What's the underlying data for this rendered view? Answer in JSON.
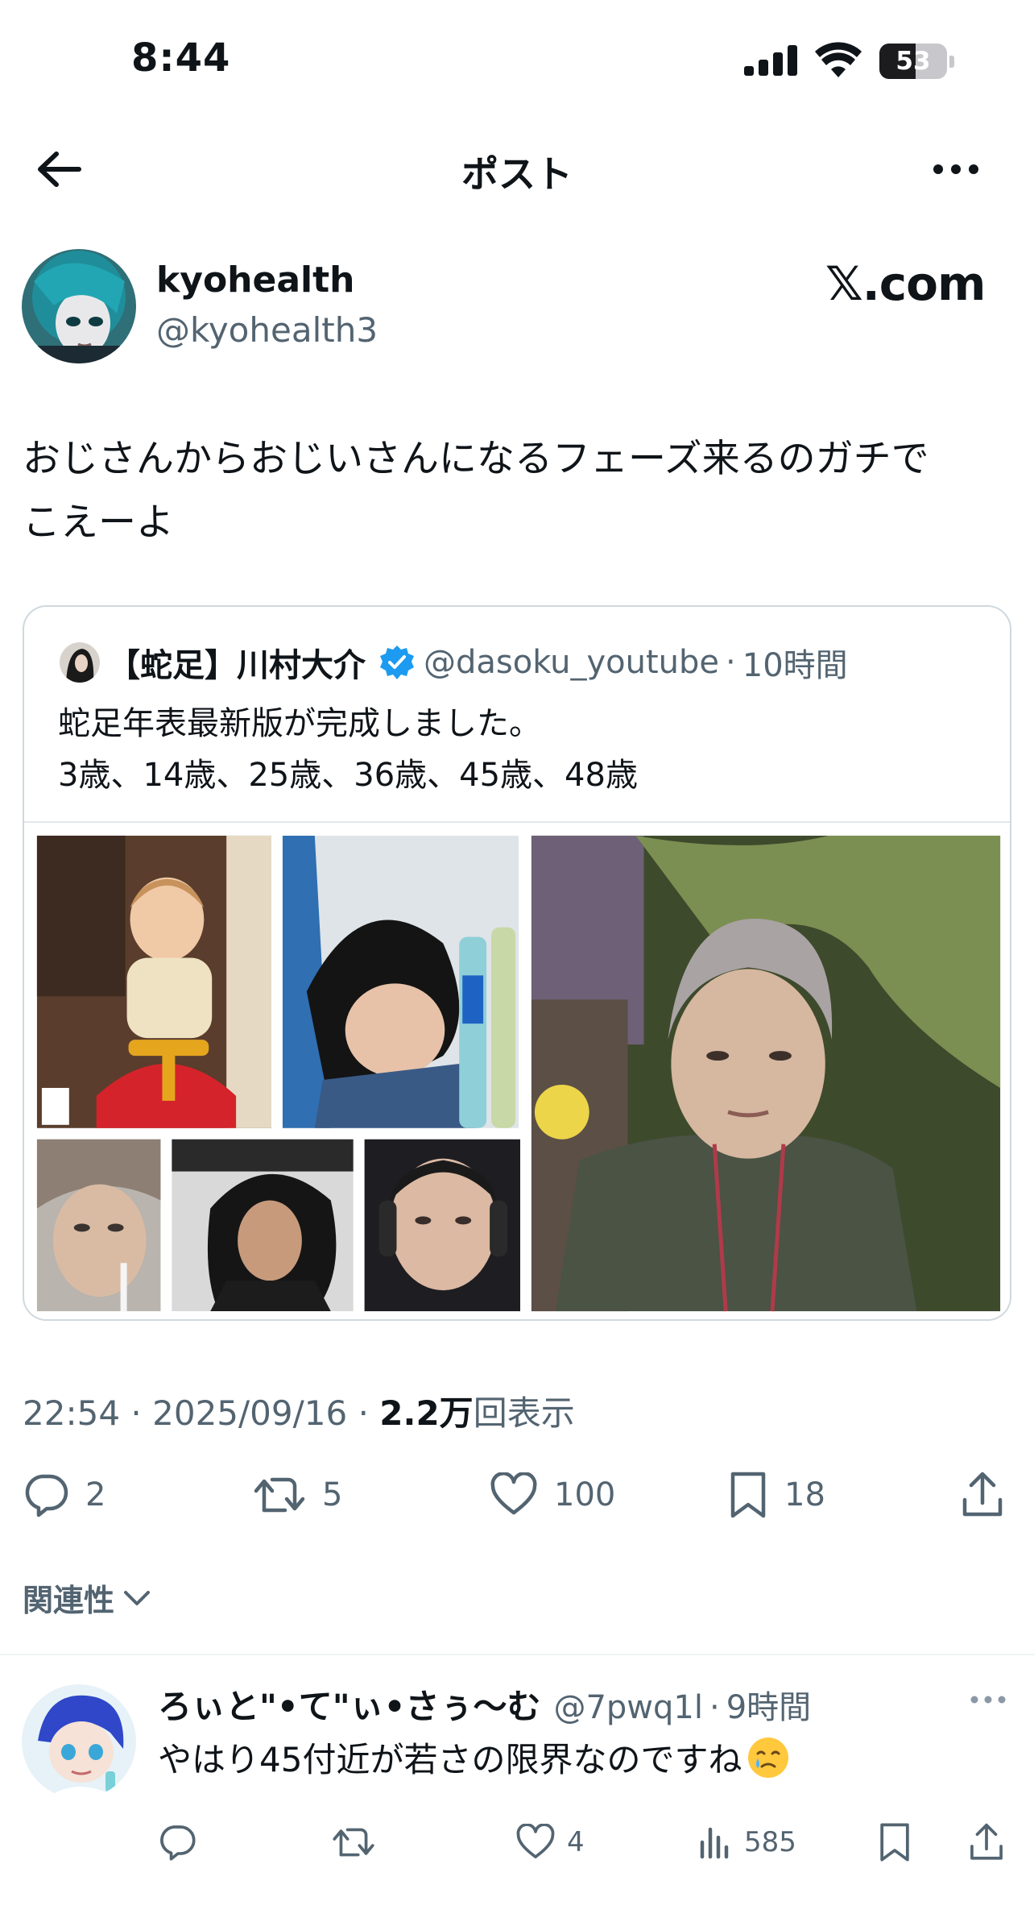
{
  "status_bar": {
    "time": "8:44",
    "battery": "53",
    "battery_level": 0.53
  },
  "nav": {
    "title": "ポスト"
  },
  "tweet": {
    "author_name": "kyohealth",
    "author_handle": "@kyohealth3",
    "watermark": "𝕏.com",
    "text_line1": "おじさんからおじいさんになるフェーズ来るのガチで",
    "text_line2": "こえーよ",
    "time": "22:54",
    "date": "2025/09/16",
    "views_count": "2.2万",
    "views_label": "回表示",
    "sep": "·",
    "replies": "2",
    "retweets": "5",
    "likes": "100",
    "bookmarks": "18"
  },
  "quote": {
    "name": "【蛇足】川村大介",
    "handle": "@dasoku_youtube",
    "time": "10時間",
    "sep": "·",
    "line1": "蛇足年表最新版が完成しました。",
    "line2": "3歳、14歳、25歳、36歳、45歳、48歳"
  },
  "sort": {
    "label": "関連性"
  },
  "reply": {
    "name": "ろぃと\"•て\"ぃ•さぅ〜む",
    "handle": "@7pwq1l",
    "time": "9時間",
    "sep": "·",
    "text": "やはり45付近が若さの限界なのですね",
    "likes": "4",
    "views": "585"
  },
  "colors": {
    "text": "#0f1419",
    "secondary": "#536471",
    "border": "#cfd9de",
    "verified": "#1d9bf0"
  }
}
